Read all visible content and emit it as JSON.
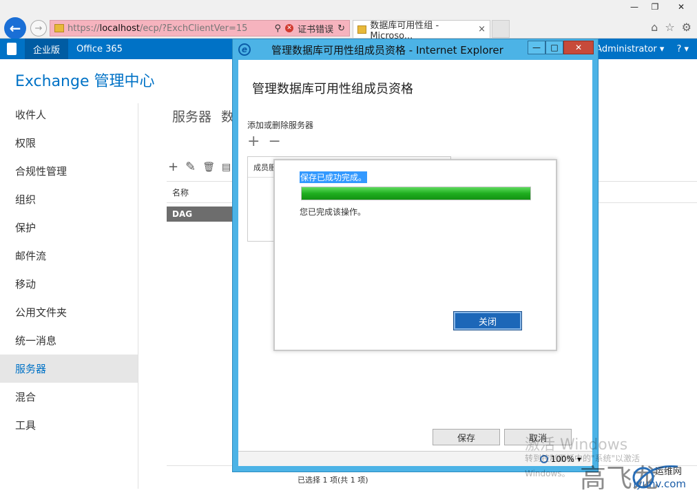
{
  "browser": {
    "window_controls": {
      "minimize": "—",
      "maximize": "❐",
      "close": "✕"
    },
    "back": "←",
    "forward": "→",
    "address": {
      "prefix": "https://",
      "host": "localhost",
      "path": "/ecp/?ExchClientVer=15",
      "search_icon": "⚲",
      "cert_error": "证书错误",
      "refresh": "↻"
    },
    "tab_title": "数据库可用性组 - Microso...",
    "tab_close": "×",
    "tools": {
      "home": "⌂",
      "favorites": "☆",
      "settings": "⚙"
    }
  },
  "suitebar": {
    "items": [
      "企业版",
      "Office 365"
    ],
    "user": "Administrator ▾",
    "help": "? ▾"
  },
  "ecp": {
    "title": "Exchange 管理中心",
    "nav": [
      "收件人",
      "权限",
      "合规性管理",
      "组织",
      "保护",
      "邮件流",
      "移动",
      "公用文件夹",
      "统一消息",
      "服务器",
      "混合",
      "工具"
    ],
    "page_title": "服务器",
    "page_title_tail": "数",
    "list_tools": {
      "add": "+",
      "edit": "✎",
      "delete": "🗑",
      "more": "▤"
    },
    "column_name": "名称",
    "row": "DAG",
    "selection_status": "已选择 1 项(共 1 项)"
  },
  "ie_dialog": {
    "window_title": "管理数据库可用性组成员资格 - Internet Explorer",
    "controls": {
      "minimize": "—",
      "maximize": "□",
      "close": "✕"
    },
    "heading": "管理数据库可用性组成员资格",
    "subheading": "添加或删除服务器",
    "add": "+",
    "remove": "−",
    "member_header": "成员服",
    "save": "保存",
    "cancel": "取消",
    "zoom": "100%",
    "zoom_arrow": "▾"
  },
  "progress_popup": {
    "message": "保存已成功完成。",
    "progress": 1.0,
    "done_text": "您已完成该操作。",
    "close_button": "关闭"
  },
  "watermarks": {
    "activate": "激活 Windows",
    "activate_sub": "转到控制面板中的\"系统\"以激活",
    "windows": "Windows。",
    "site_name": "高飞龙",
    "site_logo": "运维网",
    "site_url": "iyunv.com"
  }
}
